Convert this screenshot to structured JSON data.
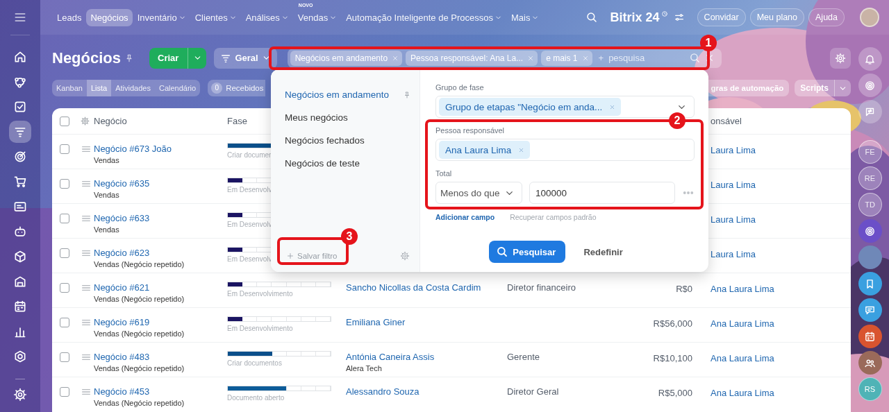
{
  "sidebar": {
    "items": [
      {
        "kind": "home",
        "selected": false
      },
      {
        "kind": "flow",
        "selected": false
      },
      {
        "kind": "task",
        "selected": false
      },
      {
        "kind": "funnel",
        "selected": true
      },
      {
        "kind": "target",
        "selected": false
      },
      {
        "kind": "cart",
        "selected": false
      },
      {
        "kind": "card",
        "selected": false
      },
      {
        "kind": "robot",
        "selected": false
      },
      {
        "kind": "cube",
        "selected": false
      },
      {
        "kind": "store",
        "selected": false
      },
      {
        "kind": "calendar",
        "selected": false
      },
      {
        "kind": "chart",
        "selected": false
      },
      {
        "kind": "hexagon",
        "selected": false
      }
    ]
  },
  "topbar": {
    "items": [
      {
        "label": "Leads",
        "selected": false
      },
      {
        "label": "Negócios",
        "selected": true
      },
      {
        "label": "Inventário",
        "selected": false,
        "dropdown": true
      },
      {
        "label": "Clientes",
        "selected": false,
        "dropdown": true
      },
      {
        "label": "Análises",
        "selected": false,
        "dropdown": true
      },
      {
        "label": "Vendas",
        "selected": false,
        "dropdown": true,
        "badge": "NOVO"
      },
      {
        "label": "Automação Inteligente de Processos",
        "selected": false,
        "dropdown": true
      },
      {
        "label": "Mais",
        "selected": false,
        "dropdown": true
      }
    ],
    "logo": "Bitrix 24",
    "buttons": [
      "Convidar",
      "Meu plano",
      "Ajuda"
    ]
  },
  "page": {
    "title": "Negócios",
    "create_button": "Criar",
    "preset_button": "Geral",
    "filter": {
      "tags": [
        "Negócios em andamento",
        "Pessoa responsável: Ana La...",
        "e mais 1"
      ],
      "add_symbol": "+",
      "placeholder": "pesquisa"
    },
    "views": [
      {
        "label": "Kanban",
        "selected": false
      },
      {
        "label": "Lista",
        "selected": true
      },
      {
        "label": "Atividades",
        "selected": false
      },
      {
        "label": "Calendário",
        "selected": false
      }
    ],
    "counter": {
      "count": "0",
      "label": "Recebidos"
    },
    "automation_button": "gras de automação",
    "scripts_button": "Scripts"
  },
  "table": {
    "all_checked": false,
    "columns": [
      "Negócio",
      "Fase",
      "onsável"
    ],
    "rows": [
      {
        "checked": false,
        "deal": "Negócio #673 João",
        "pipeline": "Vendas",
        "phase": {
          "label": "Criar documen",
          "level": 0.43,
          "color": "#0b4f8a"
        },
        "responsible": "Laura Lima"
      },
      {
        "checked": false,
        "deal": "Negócio #635",
        "pipeline": "Vendas",
        "phase": {
          "label": "Em Desenvolv",
          "level": 0.14,
          "color": "#1b1462"
        },
        "responsible": "Laura Lima"
      },
      {
        "checked": false,
        "deal": "Negócio #633",
        "pipeline": "Vendas",
        "phase": {
          "label": "Em Desenvolv",
          "level": 0.14,
          "color": "#1b1462"
        },
        "responsible": "Laura Lima"
      },
      {
        "checked": false,
        "deal": "Negócio #623",
        "pipeline": "Vendas (Negócio repetido)",
        "phase": {
          "label": "Em Desenvolv",
          "level": 0.14,
          "color": "#1b1462"
        },
        "responsible": "Laura Lima"
      },
      {
        "checked": false,
        "deal": "Negócio #621",
        "pipeline": "Vendas (Negócio repetido)",
        "phase": {
          "label": "Em Desenvolvimento",
          "level": 0.14,
          "color": "#1b1462"
        },
        "client": "Sancho Nicollas da Costa Cardim",
        "position": "Diretor financeiro",
        "amount": "R$0",
        "responsible": "Ana Laura Lima"
      },
      {
        "checked": false,
        "deal": "Negócio #619",
        "pipeline": "Vendas (Negócio repetido)",
        "phase": {
          "label": "Em Desenvolvimento",
          "level": 0.14,
          "color": "#1b1462"
        },
        "client": "Emiliana Giner",
        "amount": "R$56,000",
        "responsible": "Ana Laura Lima"
      },
      {
        "checked": false,
        "deal": "Negócio #483",
        "pipeline": "Vendas (Negócio repetido)",
        "phase": {
          "label": "Criar documentos",
          "level": 0.43,
          "color": "#0b4f8a"
        },
        "client": "Antónia Caneira Assis",
        "client_company": "Alera Tech",
        "position": "Gerente",
        "amount": "R$10,100",
        "responsible": "Ana Laura Lima"
      },
      {
        "checked": false,
        "deal": "Negócio #453",
        "pipeline": "Vendas (Negócio repetido)",
        "phase": {
          "label": "Documento aberto",
          "level": 0.57,
          "color": "#0d5c99"
        },
        "client": "Alessandro Souza",
        "position": "Diretor Geral",
        "amount": "R$5,000",
        "responsible": "Ana Laura Lima"
      }
    ]
  },
  "filter_popup": {
    "presets": [
      {
        "label": "Negócios em andamento",
        "selected": true,
        "pinned": true
      },
      {
        "label": "Meus negócios",
        "selected": false
      },
      {
        "label": "Negócios fechados",
        "selected": false
      },
      {
        "label": "Negócios de teste",
        "selected": false
      }
    ],
    "save_button": "Salvar filtro",
    "fields": [
      {
        "kind": "tags",
        "label": "Grupo de fase",
        "tags": [
          "Grupo de etapas \"Negócio em anda..."
        ],
        "dropdown": true
      },
      {
        "kind": "tags",
        "label": "Pessoa responsável",
        "tags": [
          "Ana Laura Lima"
        ]
      },
      {
        "kind": "range",
        "label": "Total",
        "operator": "Menos do que",
        "value": "100000"
      }
    ],
    "add_field": "Adicionar campo",
    "restore_fields": "Recuperar campos padrão",
    "search_button": "Pesquisar",
    "reset_button": "Redefinir"
  },
  "rail": {
    "items": [
      {
        "kind": "bell"
      },
      {
        "kind": "swirl"
      },
      {
        "kind": "chat-arrows"
      },
      {
        "kind": "initials",
        "text": "FE"
      },
      {
        "kind": "initials",
        "text": "RE"
      },
      {
        "kind": "initials",
        "text": "TD"
      },
      {
        "kind": "swirl",
        "color": "#6b4fc8"
      },
      {
        "kind": "avatar"
      },
      {
        "kind": "bookmark",
        "color": "#3aa0e0"
      },
      {
        "kind": "chat",
        "color": "#3aa0e0"
      },
      {
        "kind": "calendar",
        "color": "#d9542f"
      },
      {
        "kind": "people",
        "color": "#9a6a5a"
      },
      {
        "kind": "initials",
        "text": "RS",
        "color": "#4fb3b6"
      }
    ]
  },
  "annotations": [
    {
      "number": "1"
    },
    {
      "number": "2"
    },
    {
      "number": "3"
    }
  ]
}
